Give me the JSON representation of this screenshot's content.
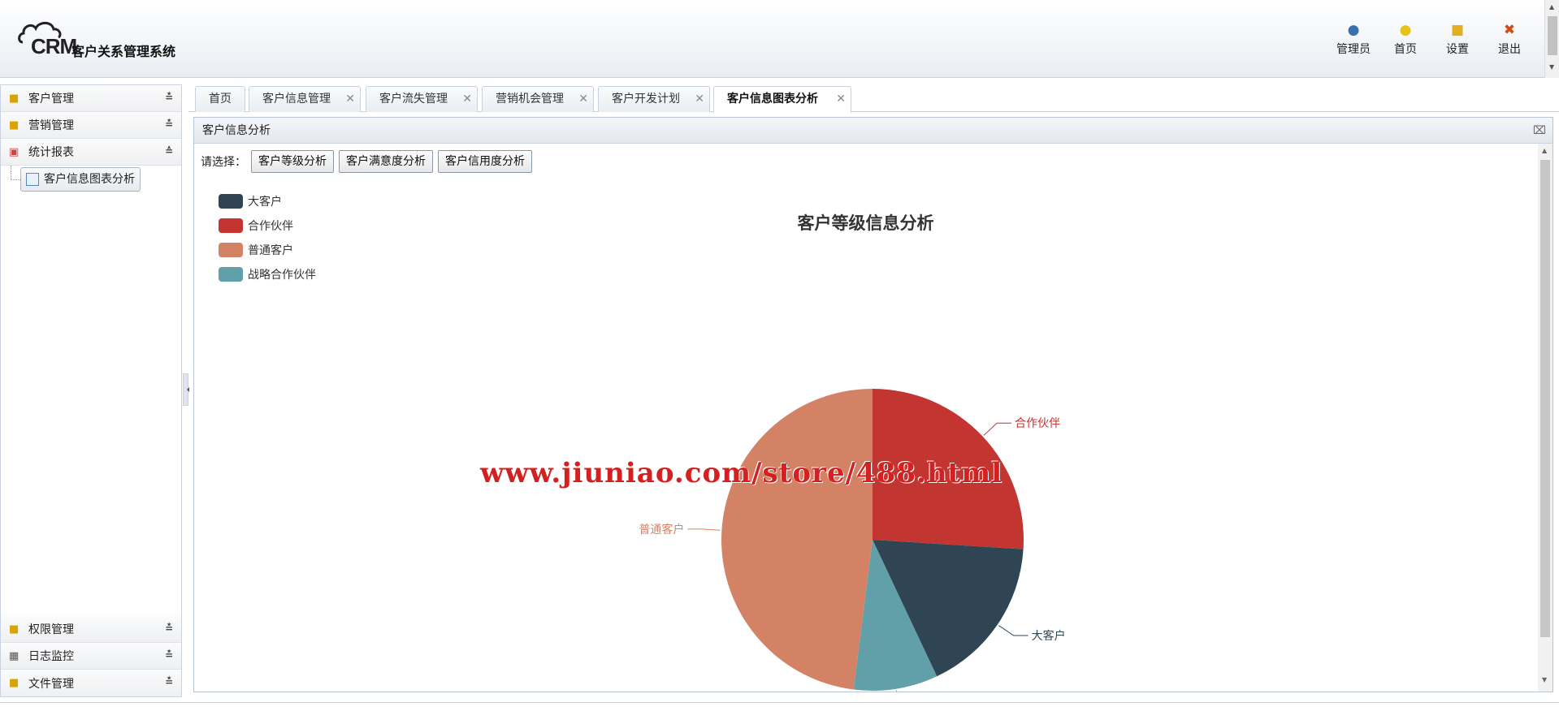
{
  "app": {
    "logo_text": "CRM",
    "title": "客户关系管理系统"
  },
  "top_nav": [
    {
      "label": "管理员",
      "icon": "user-icon"
    },
    {
      "label": "首页",
      "icon": "lightbulb-icon"
    },
    {
      "label": "设置",
      "icon": "lock-icon"
    },
    {
      "label": "退出",
      "icon": "close-icon"
    }
  ],
  "sidebar": {
    "sections": [
      {
        "label": "客户管理",
        "icon": "folder-icon"
      },
      {
        "label": "营销管理",
        "icon": "folder-icon"
      },
      {
        "label": "统计报表",
        "icon": "report-icon"
      }
    ],
    "sub_item": "客户信息图表分析",
    "bottom_sections": [
      {
        "label": "权限管理",
        "icon": "lock-icon"
      },
      {
        "label": "日志监控",
        "icon": "monitor-icon"
      },
      {
        "label": "文件管理",
        "icon": "folder-icon"
      }
    ]
  },
  "tabs": [
    {
      "label": "首页"
    },
    {
      "label": "客户信息管理"
    },
    {
      "label": "客户流失管理"
    },
    {
      "label": "营销机会管理"
    },
    {
      "label": "客户开发计划"
    },
    {
      "label": "客户信息图表分析"
    }
  ],
  "panel": {
    "title": "客户信息分析",
    "choose_label": "请选择：",
    "buttons": [
      "客户等级分析",
      "客户满意度分析",
      "客户信用度分析"
    ]
  },
  "watermark": "www.jiuniao.com/store/488.html",
  "colors": {
    "header_bg": "#e9edf3",
    "border": "#c9d3df",
    "watermark": "#d32020"
  },
  "chart_data": {
    "type": "pie",
    "title": "客户等级信息分析",
    "legend_position": "top-left",
    "categories": [
      "大客户",
      "合作伙伴",
      "普通客户",
      "战略合作伙伴"
    ],
    "values": [
      17,
      26,
      48,
      9
    ],
    "colors": [
      "#2f4554",
      "#c23531",
      "#d48265",
      "#61a0a8"
    ]
  }
}
